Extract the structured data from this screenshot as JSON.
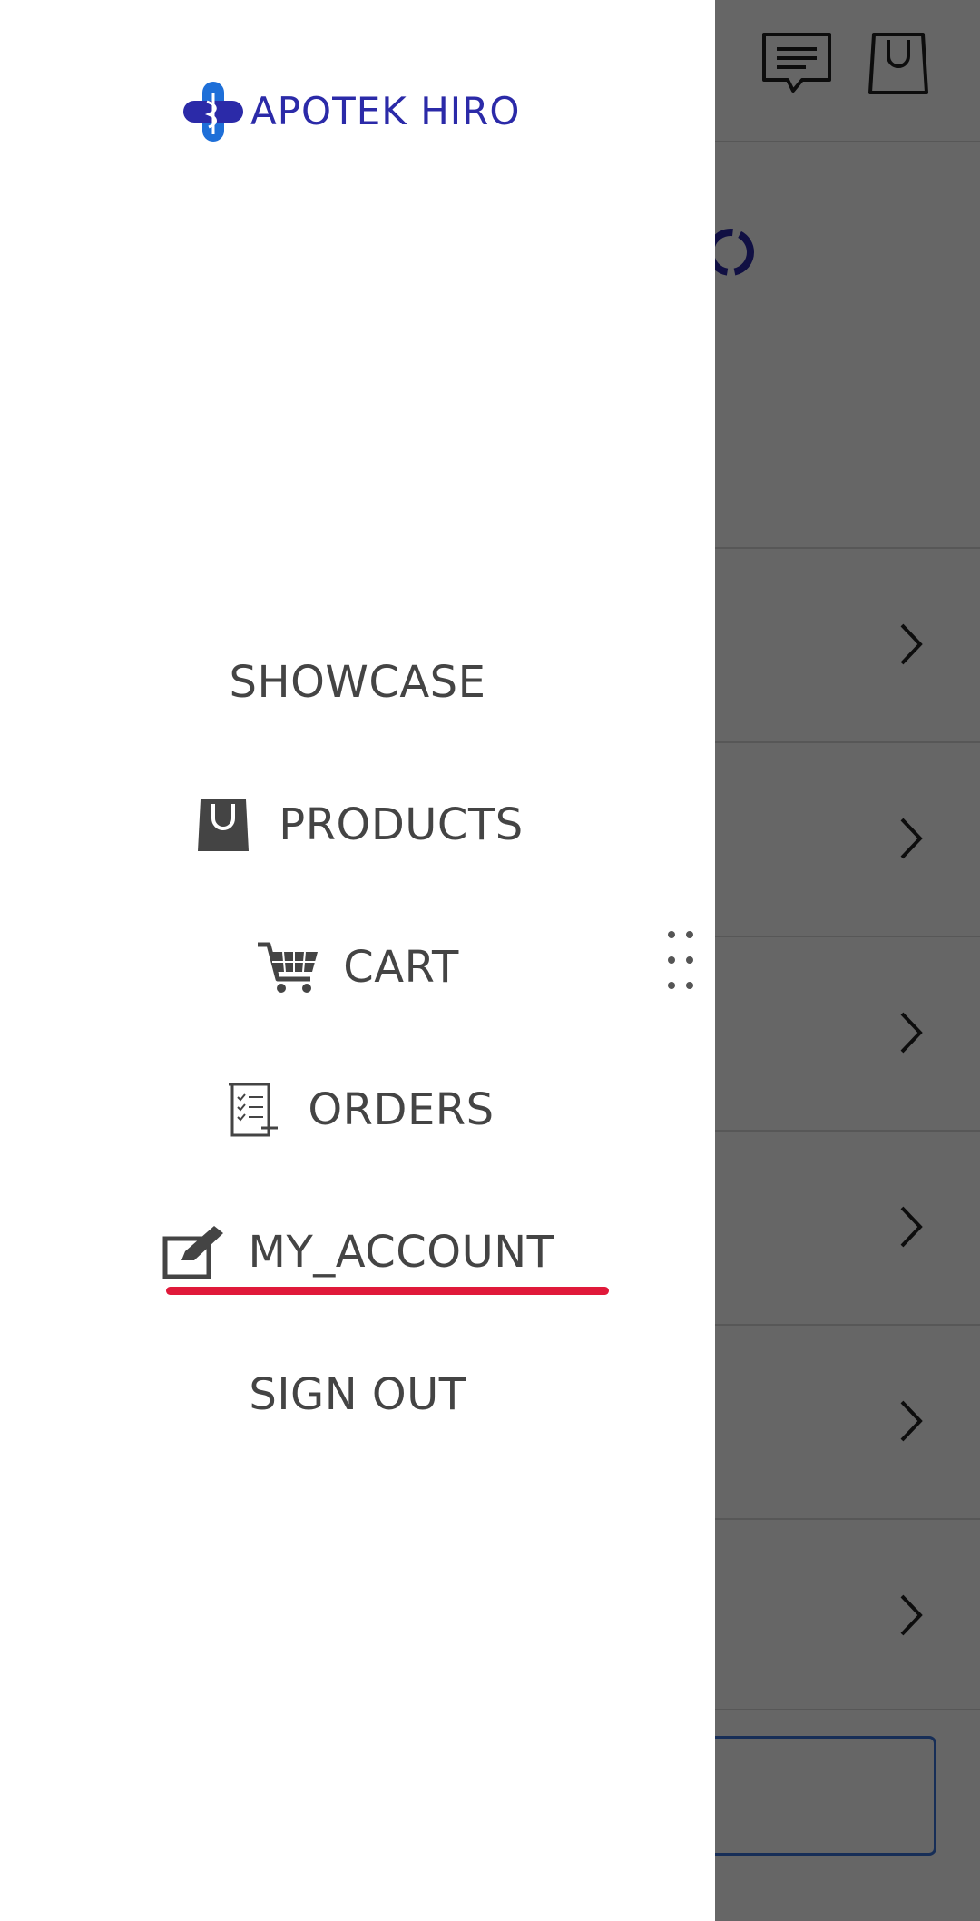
{
  "brand": {
    "name": "APOTEK HIRO",
    "color": "#2b2aa8",
    "accent": "#1e6fd8"
  },
  "header_icons": [
    {
      "name": "chat-icon"
    },
    {
      "name": "shopping-bag-icon"
    }
  ],
  "drawer": {
    "menu": [
      {
        "key": "showcase",
        "label": "SHOWCASE",
        "icon": ""
      },
      {
        "key": "products",
        "label": "PRODUCTS",
        "icon": "shopping-bag-icon"
      },
      {
        "key": "cart",
        "label": "CART",
        "icon": "cart-icon"
      },
      {
        "key": "orders",
        "label": "ORDERS",
        "icon": "orders-list-icon"
      },
      {
        "key": "my_account",
        "label": "MY_ACCOUNT",
        "icon": "edit-icon",
        "active": true
      },
      {
        "key": "sign_out",
        "label": "SIGN OUT",
        "icon": ""
      }
    ],
    "active_underline_color": "#e0193a",
    "text_color": "#444444"
  },
  "background_list": {
    "row_count": 6,
    "row_icon": "chevron-right-icon"
  }
}
